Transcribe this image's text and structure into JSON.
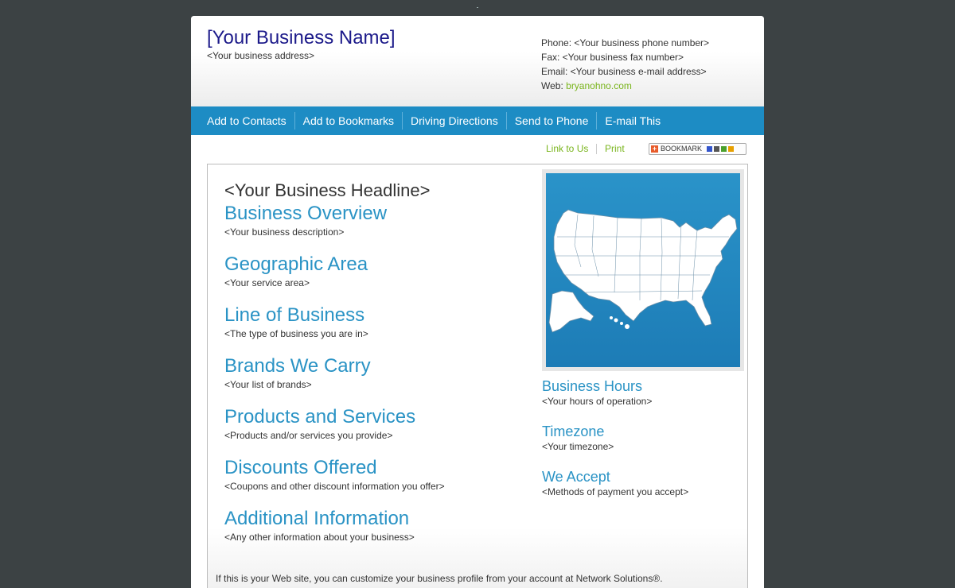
{
  "header": {
    "business_name": "[Your Business Name]",
    "business_address": "<Your business address>",
    "phone": "Phone: <Your business phone number>",
    "fax": "Fax: <Your business fax number>",
    "email": "Email: <Your business e-mail address>",
    "web_label": "Web:",
    "web_link": "bryanohno.com"
  },
  "nav": {
    "items": [
      "Add to Contacts",
      "Add to Bookmarks",
      "Driving Directions",
      "Send to Phone",
      "E-mail This"
    ]
  },
  "utility": {
    "link_to_us": "Link to Us",
    "print": "Print",
    "bookmark": "BOOKMARK"
  },
  "main": {
    "headline": "<Your Business Headline>",
    "sections": [
      {
        "title": "Business Overview",
        "text": "<Your business description>"
      },
      {
        "title": "Geographic Area",
        "text": "<Your service area>"
      },
      {
        "title": "Line of Business",
        "text": "<The type of business you are in>"
      },
      {
        "title": "Brands We Carry",
        "text": "<Your list of brands>"
      },
      {
        "title": "Products and Services",
        "text": "<Products and/or services you provide>"
      },
      {
        "title": "Discounts Offered",
        "text": "<Coupons and other discount information you offer>"
      },
      {
        "title": "Additional Information",
        "text": "<Any other information about your business>"
      }
    ]
  },
  "sidebar": {
    "items": [
      {
        "title": "Business Hours",
        "text": "<Your hours of operation>"
      },
      {
        "title": "Timezone",
        "text": "<Your timezone>"
      },
      {
        "title": "We Accept",
        "text": "<Methods of payment you accept>"
      }
    ]
  },
  "footer": {
    "note": "If this is your Web site, you can customize your business profile from your account at Network Solutions®."
  },
  "colors": {
    "nav_blue": "#1d8cc4",
    "heading_blue": "#2a93c5",
    "link_green": "#7ab51d",
    "name_navy": "#1c1a8a"
  }
}
